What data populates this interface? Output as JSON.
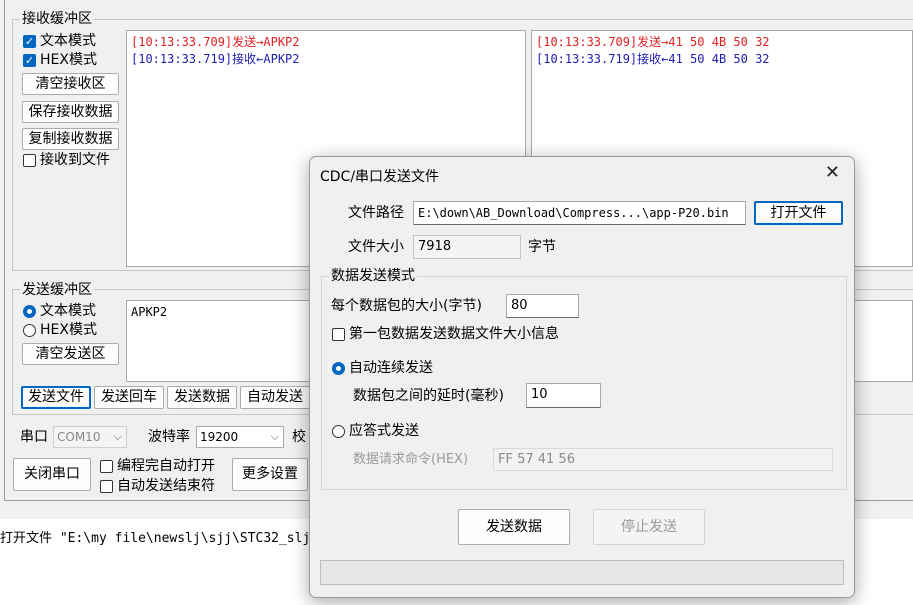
{
  "receive": {
    "group_title": "接收缓冲区",
    "text_mode": "文本模式",
    "hex_mode": "HEX模式",
    "clear_btn": "清空接收区",
    "save_btn": "保存接收数据",
    "copy_btn": "复制接收数据",
    "to_file": "接收到文件",
    "text_lines": [
      "[10:13:33.709]发送→APKP2",
      "[10:13:33.719]接收←APKP2"
    ],
    "hex_lines": [
      "[10:13:33.709]发送→41 50 4B 50 32",
      "[10:13:33.719]接收←41 50 4B 50 32"
    ]
  },
  "send": {
    "group_title": "发送缓冲区",
    "text_mode": "文本模式",
    "hex_mode": "HEX模式",
    "clear_btn": "清空发送区",
    "content": "APKP2",
    "buttons": [
      "发送文件",
      "发送回车",
      "发送数据",
      "自动发送"
    ]
  },
  "port": {
    "port_label": "串口",
    "port_value": "COM10",
    "baud_label": "波特率",
    "baud_value": "19200",
    "check_label": "校",
    "close_btn": "关闭串口",
    "auto_open": "编程完自动打开",
    "auto_send_end": "自动发送结束符",
    "more_btn": "更多设置"
  },
  "status_text": "打开文件 \"E:\\my file\\newslj\\sjj\\STC32_slj\\",
  "dialog": {
    "title": "CDC/串口发送文件",
    "close_icon": "✕",
    "path_label": "文件路径",
    "path_value": "E:\\down\\AB_Download\\Compress...\\app-P20.bin",
    "open_btn": "打开文件",
    "size_label": "文件大小",
    "size_value": "7918",
    "size_unit": "字节",
    "mode_group": "数据发送模式",
    "packet_label": "每个数据包的大小(字节)",
    "packet_value": "80",
    "first_packet": "第一包数据发送数据文件大小信息",
    "auto_continuous": "自动连续发送",
    "delay_label": "数据包之间的延时(毫秒)",
    "delay_value": "10",
    "ack_mode": "应答式发送",
    "request_label": "数据请求命令(HEX)",
    "request_value": "FF 57 41 56",
    "send_btn": "发送数据",
    "stop_btn": "停止发送"
  }
}
